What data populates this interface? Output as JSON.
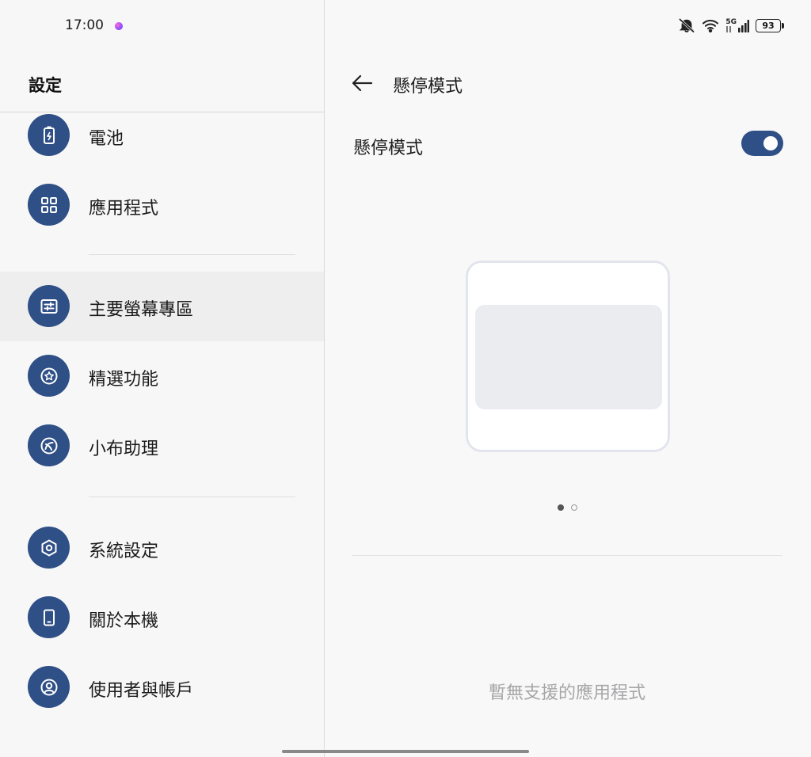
{
  "status_bar": {
    "time": "17:00",
    "network": "5G",
    "battery": "93"
  },
  "left": {
    "title": "設定",
    "items": [
      {
        "label": "電池",
        "icon": "battery-icon",
        "active": false
      },
      {
        "label": "應用程式",
        "icon": "apps-grid-icon",
        "active": false
      },
      {
        "label": "主要螢幕專區",
        "icon": "sliders-icon",
        "active": true
      },
      {
        "label": "精選功能",
        "icon": "star-icon",
        "active": false
      },
      {
        "label": "小布助理",
        "icon": "assistant-icon",
        "active": false
      },
      {
        "label": "系統設定",
        "icon": "hexagon-gear-icon",
        "active": false
      },
      {
        "label": "關於本機",
        "icon": "phone-icon",
        "active": false
      },
      {
        "label": "使用者與帳戶",
        "icon": "user-icon",
        "active": false
      }
    ]
  },
  "right": {
    "title": "懸停模式",
    "setting_label": "懸停模式",
    "toggle_on": true,
    "pager": {
      "count": 2,
      "current": 1
    },
    "empty_message": "暫無支援的應用程式"
  },
  "colors": {
    "accent": "#2f4f87",
    "background": "#f7f7f8",
    "active_row": "#eeeeef"
  }
}
